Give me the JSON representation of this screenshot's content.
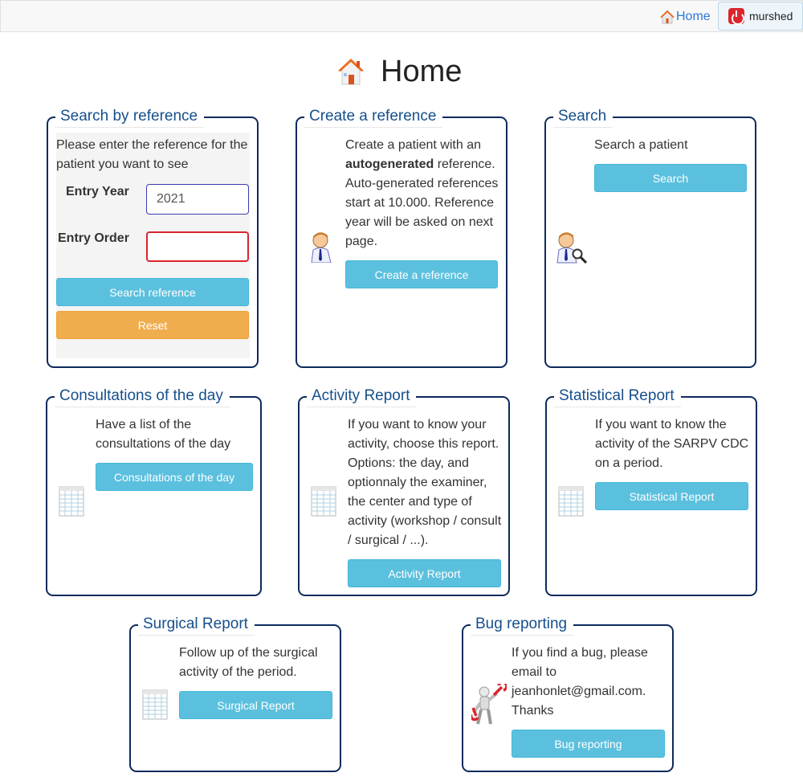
{
  "navbar": {
    "home_label": "Home",
    "user_label": "murshed"
  },
  "page": {
    "title": "Home"
  },
  "search_by_reference": {
    "legend": "Search by reference",
    "intro": "Please enter the reference for the patient you want to see",
    "entry_year_label": "Entry Year",
    "entry_year_value": "2021",
    "entry_order_label": "Entry Order",
    "entry_order_value": "",
    "search_button": "Search reference",
    "reset_button": "Reset"
  },
  "create_reference": {
    "legend": "Create a reference",
    "text_before": "Create a patient with an ",
    "text_bold": "autogenerated",
    "text_after": " reference. Auto-generated references start at 10.000. Reference year will be asked on next page.",
    "button": "Create a reference"
  },
  "search": {
    "legend": "Search",
    "text": "Search a patient",
    "button": "Search"
  },
  "consultations": {
    "legend": "Consultations of the day",
    "text": "Have a list of the consultations of the day",
    "button": "Consultations of the day"
  },
  "activity_report": {
    "legend": "Activity Report",
    "text": "If you want to know your activity, choose this report. Options: the day, and optionnaly the examiner, the center and type of activity (workshop / consult / surgical / ...).",
    "button": "Activity Report"
  },
  "statistical_report": {
    "legend": "Statistical Report",
    "text": "If you want to know the activity of the SARPV CDC on a period.",
    "button": "Statistical Report"
  },
  "surgical_report": {
    "legend": "Surgical Report",
    "text": "Follow up of the surgical activity of the period.",
    "button": "Surgical Report"
  },
  "bug_reporting": {
    "legend": "Bug reporting",
    "text": "If you find a bug, please email to jeanhonlet@gmail.com. Thanks",
    "button": "Bug reporting"
  },
  "icons": {
    "home": "home-icon",
    "power": "power-icon",
    "doctor": "doctor-icon",
    "doctor_search": "doctor-search-icon",
    "spreadsheet": "spreadsheet-icon",
    "bug_robot": "robot-wrench-icon"
  },
  "colors": {
    "panel_border": "#0d2a5c",
    "legend_text": "#164f8c",
    "info_button": "#5bc0de",
    "warning_button": "#f0ad4e",
    "invalid_border": "#d9262c",
    "link": "#2a7ad6"
  }
}
